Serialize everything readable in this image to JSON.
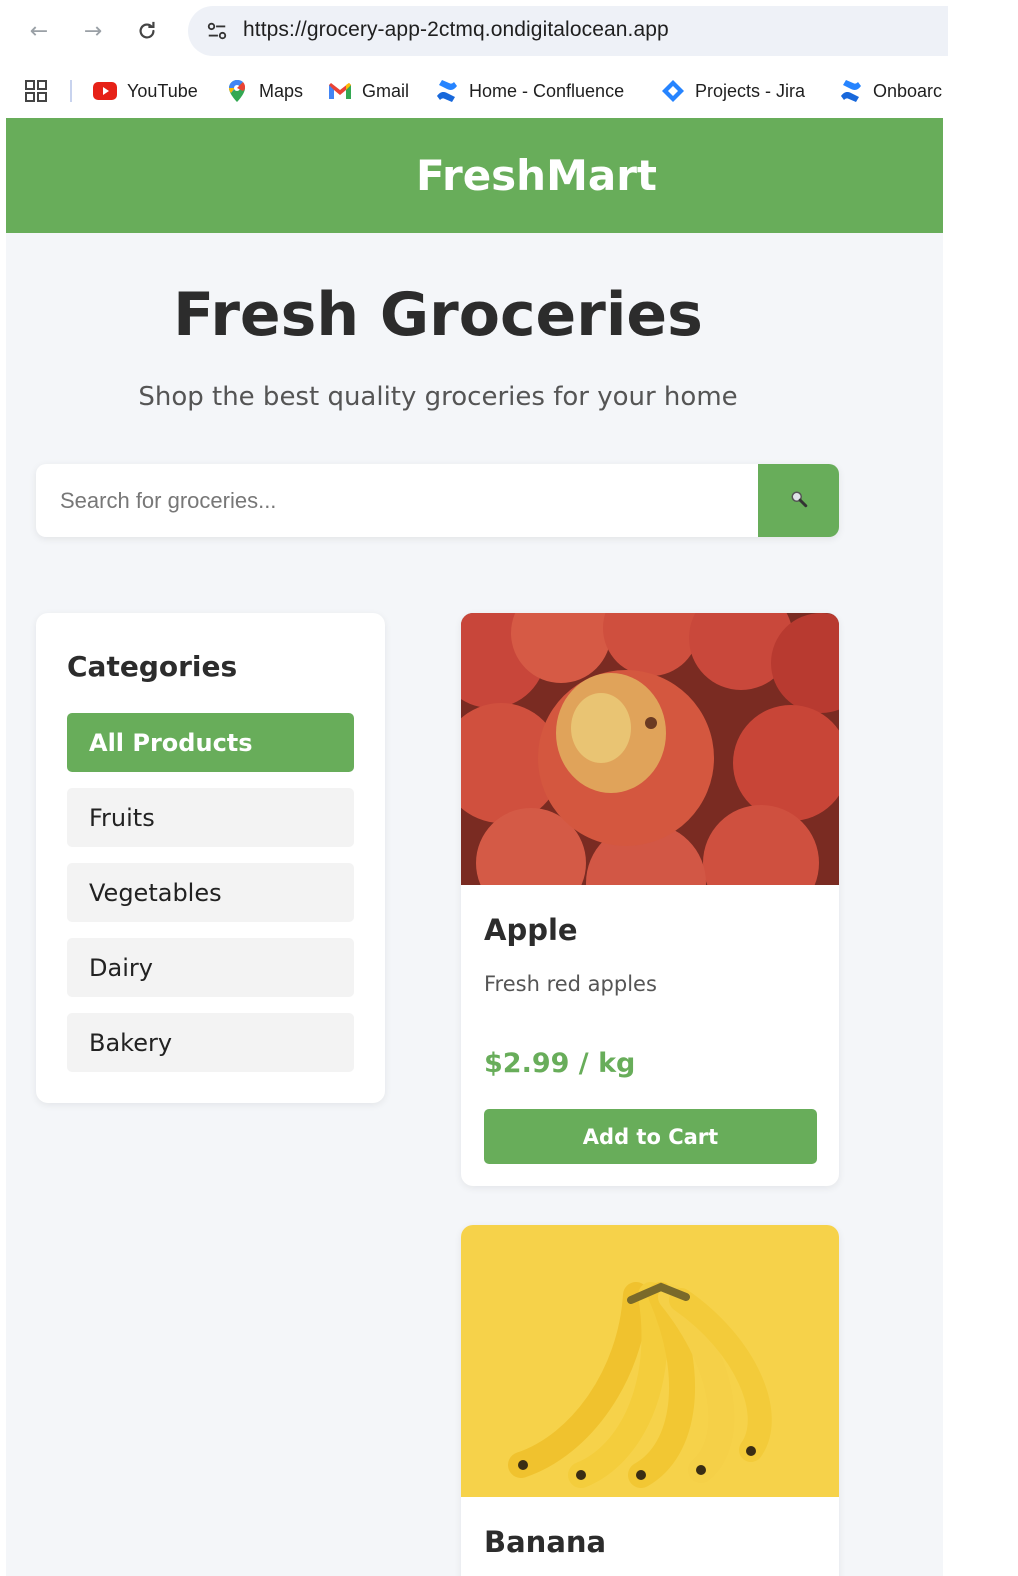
{
  "browser": {
    "url": "https://grocery-app-2ctmq.ondigitalocean.app",
    "bookmarks": [
      {
        "label": "YouTube",
        "icon": "youtube-icon"
      },
      {
        "label": "Maps",
        "icon": "maps-icon"
      },
      {
        "label": "Gmail",
        "icon": "gmail-icon"
      },
      {
        "label": "Home - Confluence",
        "icon": "confluence-icon"
      },
      {
        "label": "Projects - Jira",
        "icon": "jira-icon"
      },
      {
        "label": "Onboarc",
        "icon": "confluence-icon"
      }
    ]
  },
  "header": {
    "logo": "FreshMart"
  },
  "hero": {
    "title": "Fresh Groceries",
    "subtitle": "Shop the best quality groceries for your home"
  },
  "search": {
    "placeholder": "Search for groceries...",
    "button_icon": "magnifier-icon"
  },
  "categories": {
    "title": "Categories",
    "items": [
      {
        "label": "All Products",
        "active": true
      },
      {
        "label": "Fruits",
        "active": false
      },
      {
        "label": "Vegetables",
        "active": false
      },
      {
        "label": "Dairy",
        "active": false
      },
      {
        "label": "Bakery",
        "active": false
      }
    ]
  },
  "products": [
    {
      "name": "Apple",
      "description": "Fresh red apples",
      "price": "$2.99 / kg",
      "button": "Add to Cart",
      "image": "apples-photo"
    },
    {
      "name": "Banana",
      "image": "bananas-photo"
    }
  ],
  "colors": {
    "accent": "#68ad5a",
    "page_bg": "#f4f6f9"
  }
}
